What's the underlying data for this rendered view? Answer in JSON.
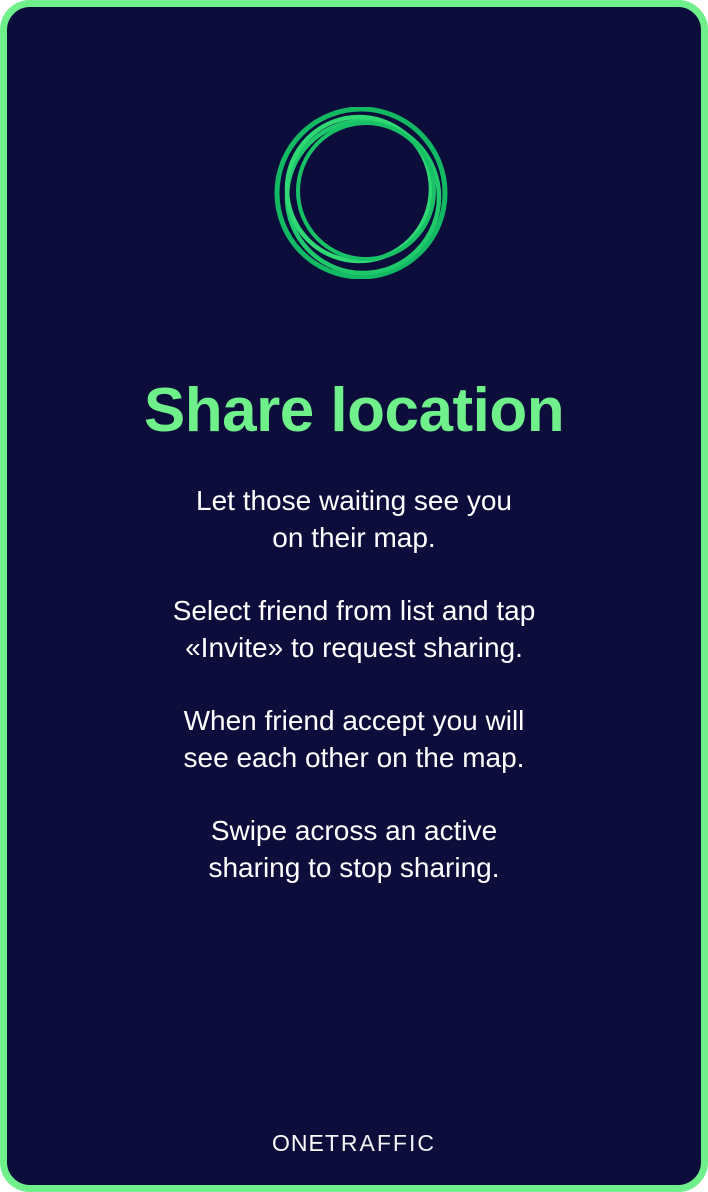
{
  "colors": {
    "background": "#0c0d3b",
    "accent": "#6ff08a",
    "ring_dark": "#10b860",
    "ring_light": "#2fd873",
    "text": "#ffffff"
  },
  "icon": "location-rings-icon",
  "title": "Share location",
  "paragraphs": [
    "Let those waiting see you\non their map.",
    "Select friend from list and tap\n«Invite» to request sharing.",
    "When friend accept you will\nsee each other on the map.",
    "Swipe  across an active\nsharing to stop sharing."
  ],
  "brand": {
    "part1": "ONE",
    "part2": "TRAFFIC"
  }
}
